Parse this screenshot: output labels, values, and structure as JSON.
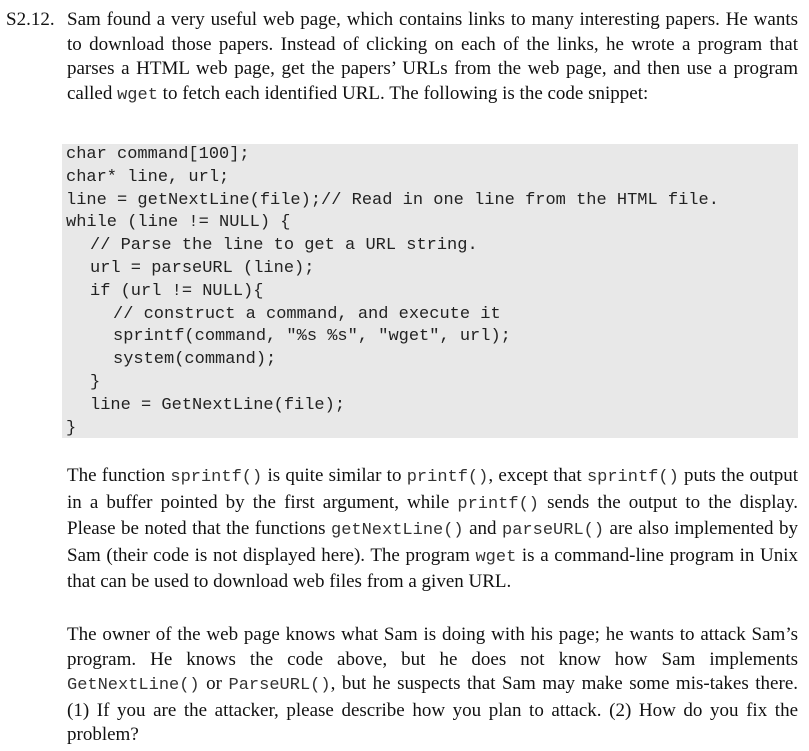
{
  "problem": {
    "label": "S2.12.",
    "intro": {
      "t1": "Sam found a very useful web page, which contains links to many interesting papers. He wants to download those papers. Instead of clicking on each of the links, he wrote a program that parses a HTML web page, get the papers’ URLs from the web page, and then use a program called ",
      "c1": "wget",
      "t2": " to fetch each identified URL. The following is the code snippet:"
    },
    "code_lines": [
      "char command[100];",
      "char* line, url;",
      "line = getNextLine(file);// Read in one line from the HTML file.",
      "while (line != NULL) {",
      "// Parse the line to get a URL string.",
      "url = parseURL (line);",
      "if (url != NULL){",
      "// construct a command, and execute it",
      "sprintf(command, \"%s %s\", \"wget\", url);",
      "system(command);",
      "}",
      "line = GetNextLine(file);",
      "}"
    ],
    "para2": {
      "t1": "The function ",
      "c1": "sprintf()",
      "t2": " is quite similar to ",
      "c2": "printf()",
      "t3": ", except that ",
      "c3": "sprintf()",
      "t4": " puts the output in a buffer pointed by the first argument, while ",
      "c4": "printf()",
      "t5": " sends the output to the display. Please be noted that the functions ",
      "c5": "getNextLine()",
      "t6": " and ",
      "c6": "parseURL()",
      "t7": " are also implemented by Sam (their code is not displayed here). The program ",
      "c7": "wget",
      "t8": " is a command-line program in Unix that can be used to download web files from a given URL."
    },
    "para3": {
      "t1": "The owner of the web page knows what Sam is doing with his page; he wants to attack Sam’s program. He knows the code above, but he does not know how Sam implements ",
      "c1": "GetNextLine()",
      "t2": " or ",
      "c2": "ParseURL()",
      "t3": ", but he suspects that Sam may make some mis-takes there. (1) If you are the attacker, please describe how you plan to attack. (2) How do you fix the problem?"
    }
  }
}
